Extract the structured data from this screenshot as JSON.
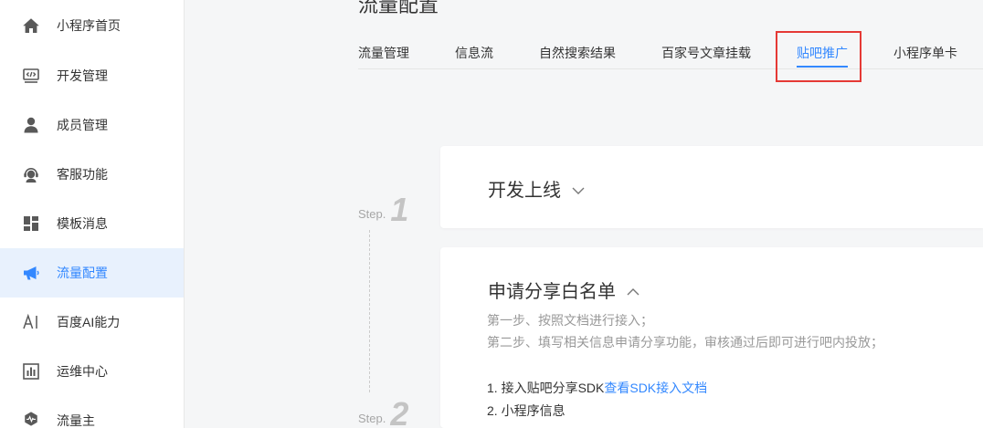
{
  "page": {
    "title": "流量配置"
  },
  "sidebar": {
    "items": [
      {
        "label": "小程序首页",
        "icon": "home-icon"
      },
      {
        "label": "开发管理",
        "icon": "code-icon"
      },
      {
        "label": "成员管理",
        "icon": "user-icon"
      },
      {
        "label": "客服功能",
        "icon": "headset-icon"
      },
      {
        "label": "模板消息",
        "icon": "template-icon"
      },
      {
        "label": "流量配置",
        "icon": "megaphone-icon",
        "active": true
      },
      {
        "label": "百度AI能力",
        "icon": "ai-icon"
      },
      {
        "label": "运维中心",
        "icon": "chart-icon"
      },
      {
        "label": "流量主",
        "icon": "hexagon-pulse-icon"
      }
    ]
  },
  "tabs": [
    {
      "label": "流量管理"
    },
    {
      "label": "信息流"
    },
    {
      "label": "自然搜索结果"
    },
    {
      "label": "百家号文章挂载"
    },
    {
      "label": "贴吧推广",
      "active": true,
      "highlighted": true
    },
    {
      "label": "小程序单卡"
    }
  ],
  "steps": [
    {
      "label": "Step.",
      "number": "1"
    },
    {
      "label": "Step.",
      "number": "2"
    }
  ],
  "cards": [
    {
      "title": "开发上线",
      "expanded": false
    },
    {
      "title": "申请分享白名单",
      "expanded": true,
      "descriptions": [
        "第一步、按照文档进行接入；",
        "第二步、填写相关信息申请分享功能，审核通过后即可进行吧内投放；"
      ],
      "items": [
        {
          "text": "1. 接入贴吧分享SDK",
          "link": "查看SDK接入文档"
        },
        {
          "text": "2. 小程序信息"
        }
      ]
    }
  ],
  "colors": {
    "accent": "#3388ff",
    "active_bg": "#e8f1fd",
    "annotation": "#e53935",
    "text": "#333333",
    "muted": "#999999",
    "background": "#f5f6f7"
  }
}
